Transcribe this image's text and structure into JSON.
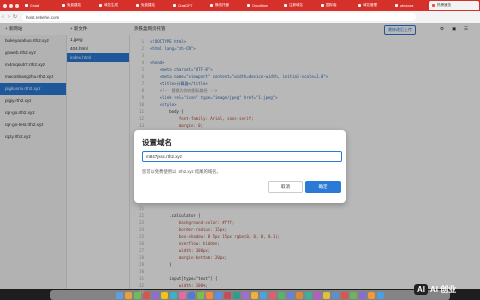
{
  "browser": {
    "tabs": [
      {
        "label": "Gmail",
        "active": false
      },
      {
        "label": "免费建站",
        "active": false
      },
      {
        "label": "域名生成",
        "active": false
      },
      {
        "label": "免费建站",
        "active": false
      },
      {
        "label": "ChatGPT",
        "active": false
      },
      {
        "label": "静态托管",
        "active": false
      },
      {
        "label": "Cloudflare",
        "active": false
      },
      {
        "label": "注册域名",
        "active": false
      },
      {
        "label": "国际版",
        "active": false
      },
      {
        "label": "域名管理",
        "active": false
      },
      {
        "label": "windows",
        "active": false
      },
      {
        "label": "热榜速览",
        "active": true
      }
    ],
    "url": "host.retiehe.com"
  },
  "app": {
    "new_site": "+ 新网站",
    "new_file": "+ 新文件",
    "editor_title": "热铁盒网页托管",
    "upload_label": "需修改后上传",
    "sites": [
      "bukeyarahuo.rth2.xyz",
      "goweb.rth2.xyz",
      "m4mqsub7.rth2.xyz",
      "macosbangzhu.rth2.xyz",
      "pigiluomi.rth2.xyz",
      "pigiy.rth2.xyz",
      "rqr-go.rth2.xyz",
      "rqr-go-test.rth2.xyz",
      "rqzy.rth2.xyz"
    ],
    "selected_site_index": 4,
    "files": [
      "1.jpeg",
      "404.html",
      "index.html"
    ],
    "selected_file_index": 2
  },
  "editor": {
    "lines": [
      {
        "n": "1",
        "t": "<!DOCTYPE html>"
      },
      {
        "n": "2",
        "t": "<html lang=\"zh-CN\">"
      },
      {
        "n": "3",
        "t": ""
      },
      {
        "n": "4",
        "t": "<head>"
      },
      {
        "n": "5",
        "t": "    <meta charset=\"UTF-8\">"
      },
      {
        "n": "6",
        "t": "    <meta name=\"viewport\" content=\"width=device-width, initial-scale=1.0\">"
      },
      {
        "n": "7",
        "t": "    <title>计算器</title>"
      },
      {
        "n": "8",
        "t": "    <!-- 替换为你的图标路径 -->"
      },
      {
        "n": "9",
        "t": "    <link rel=\"icon\" type=\"image/jpeg\" href=\"1.jpeg\">"
      },
      {
        "n": "10",
        "t": "    <style>"
      },
      {
        "n": "11",
        "t": "        body {"
      },
      {
        "n": "12",
        "t": "            font-family: Arial, sans-serif;"
      },
      {
        "n": "13",
        "t": "            margin: 0;"
      }
    ],
    "lines_below": [
      {
        "n": "21",
        "t": ""
      },
      {
        "n": "22",
        "t": "        .calculator {"
      },
      {
        "n": "23",
        "t": "            background-color: #fff;"
      },
      {
        "n": "24",
        "t": "            border-radius: 15px;"
      },
      {
        "n": "25",
        "t": "            box-shadow: 0 5px 15px rgba(0, 0, 0, 0.1);"
      },
      {
        "n": "26",
        "t": "            overflow: hidden;"
      },
      {
        "n": "27",
        "t": "            width: 300px;"
      },
      {
        "n": "28",
        "t": "            margin-bottom: 20px;"
      },
      {
        "n": "29",
        "t": "        }"
      },
      {
        "n": "30",
        "t": ""
      },
      {
        "n": "31",
        "t": "        input[type=\"text\"] {"
      },
      {
        "n": "32",
        "t": "            width: 100%;"
      },
      {
        "n": "33",
        "t": "            padding: 20px;"
      }
    ]
  },
  "modal": {
    "title": "设置域名",
    "input_value": "m847jssc.rth2.xyz",
    "hint": "您可以免费使用以 .rth2.xyz 结尾的域名。",
    "cancel_label": "取消",
    "ok_label": "确定"
  },
  "watermark": "AI 创业"
}
